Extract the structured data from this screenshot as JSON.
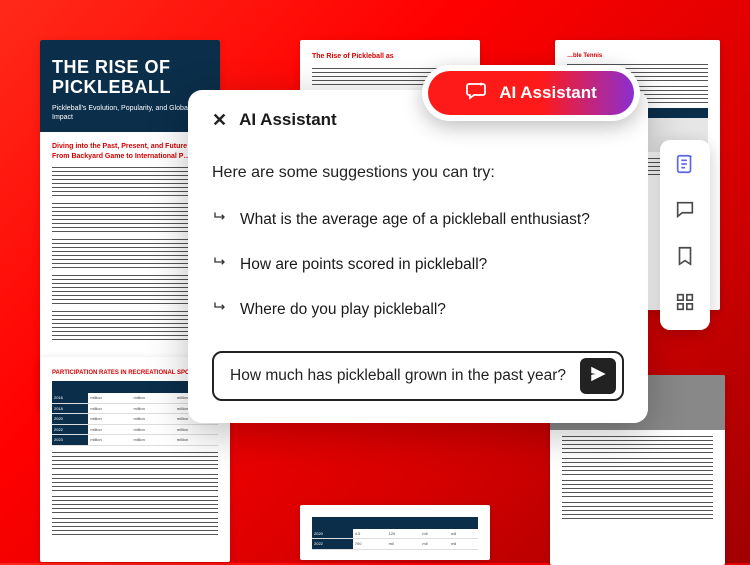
{
  "doc": {
    "cover": {
      "title": "THE RISE OF PICKLEBALL",
      "subtitle": "Pickleball's Evolution, Popularity, and Global Impact",
      "section_heading": "Diving into the Past, Present, and Future – From Backyard Game to International P…"
    },
    "page2_heading": "The Rise of Pickleball as",
    "page3_heading": "…ble Tennis",
    "page4_heading": "PARTICIPATION RATES IN RECREATIONAL SPORTS"
  },
  "assistant": {
    "pill_label": "AI Assistant",
    "panel_title": "AI Assistant",
    "intro": "Here are some suggestions you can try:",
    "suggestions": [
      "What is the average age of a pickleball enthusiast?",
      "How are points scored in pickleball?",
      "Where do you play pickleball?"
    ],
    "input_value": "How much has pickleball grown in the past year?"
  },
  "rail": {
    "items": [
      "summary",
      "chat",
      "bookmark",
      "apps"
    ]
  }
}
